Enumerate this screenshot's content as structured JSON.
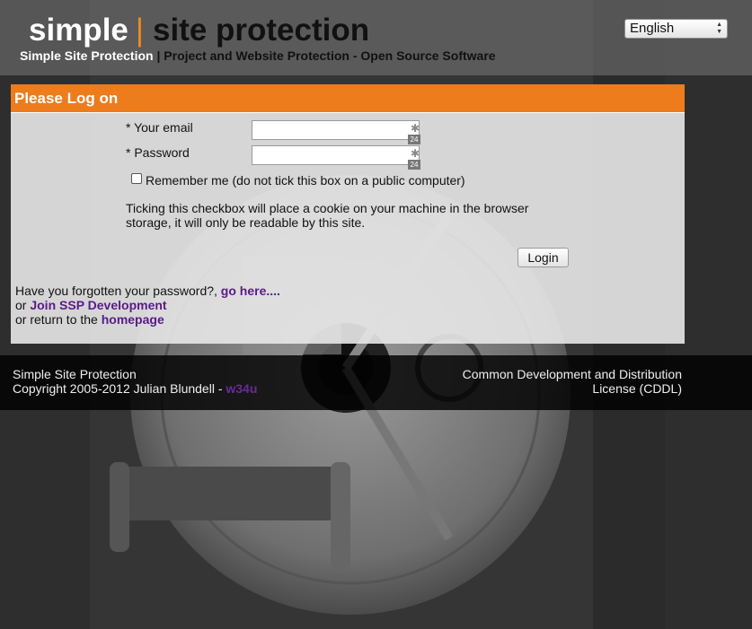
{
  "header": {
    "logo_simple": "simple",
    "logo_separator": "|",
    "logo_rest": "site protection",
    "tagline_name": "Simple Site Protection",
    "tagline_rest": "| Project and Website Protection - Open Source Software"
  },
  "language": {
    "selected": "English"
  },
  "login": {
    "title": "Please Log on",
    "email_label": "* Your email",
    "email_value": "",
    "password_label": "* Password",
    "password_value": "",
    "field_badge": "24",
    "remember_checked": false,
    "remember_label": "Remember me (do not tick this box on a public computer)",
    "note": "Ticking this checkbox will place a cookie on your machine in the browser storage, it will only be readable by this site.",
    "button": "Login"
  },
  "links": {
    "forgot_text": "Have you forgotten your password?,",
    "forgot_link": "go here....",
    "or1": "or",
    "join_link": "Join SSP Development",
    "or2": "or return to the",
    "home_link": "homepage"
  },
  "footer": {
    "left_line1": "Simple Site Protection",
    "copyright": "Copyright 2005-2012 Julian Blundell -",
    "author_link": "w34u",
    "right_line1": "Common Development and Distribution",
    "right_line2": "License (CDDL)"
  },
  "colors": {
    "accent": "#ed7c1c",
    "link": "#5a1a8a",
    "footer_bg": "#000000"
  }
}
